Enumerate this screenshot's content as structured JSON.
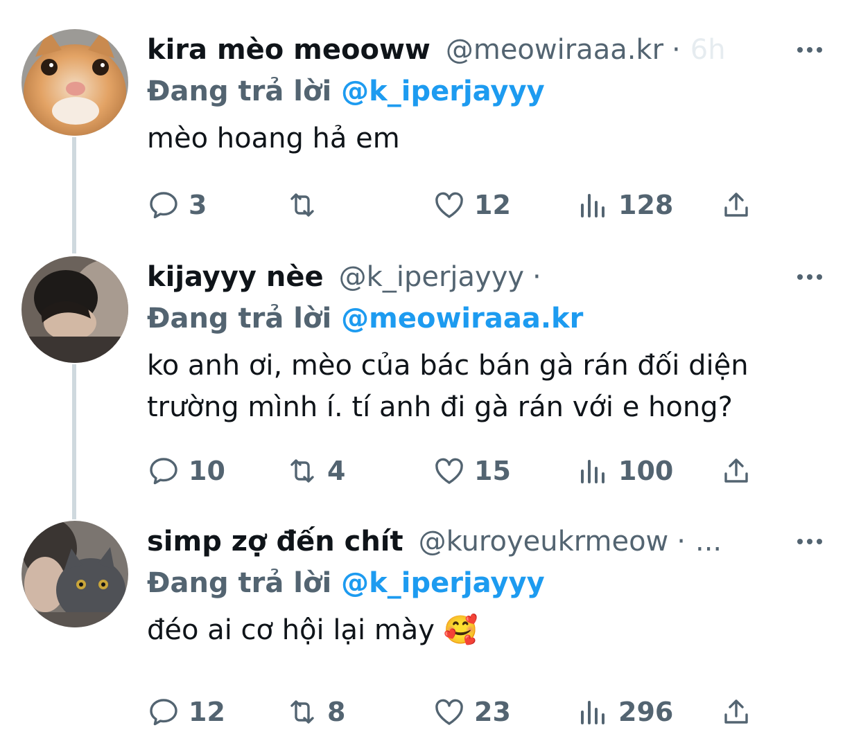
{
  "reply_label": "Đang trả lời",
  "tweets": [
    {
      "name": "kira mèo meooww",
      "handle": "@meowiraaa.kr",
      "dot": "·",
      "time": "6h",
      "reply_to": "@k_iperjayyy",
      "text": "mèo hoang hả em",
      "replies": "3",
      "retweets": "",
      "likes": "12",
      "views": "128"
    },
    {
      "name": "kijayyy nèe",
      "handle": "@k_iperjayyy",
      "dot": "·",
      "time": "",
      "reply_to": "@meowiraaa.kr",
      "text": "ko anh ơi, mèo của bác bán gà rán đối diện trường mình í. tí anh đi gà rán với e hong?",
      "replies": "10",
      "retweets": "4",
      "likes": "15",
      "views": "100"
    },
    {
      "name": "simp zợ đến chít",
      "handle": "@kuroyeukrmeow",
      "dot": "·",
      "time": "...",
      "reply_to": "@k_iperjayyy",
      "text": "đéo ai cơ hội lại mày 🥰",
      "replies": "12",
      "retweets": "8",
      "likes": "23",
      "views": "296"
    }
  ],
  "icons": [
    "reply-icon",
    "retweet-icon",
    "like-icon",
    "views-icon",
    "share-icon",
    "more-icon"
  ],
  "colors": {
    "link": "#1d9bf0",
    "secondary": "#536471",
    "text": "#0f1419",
    "thread": "#cfd9de"
  }
}
